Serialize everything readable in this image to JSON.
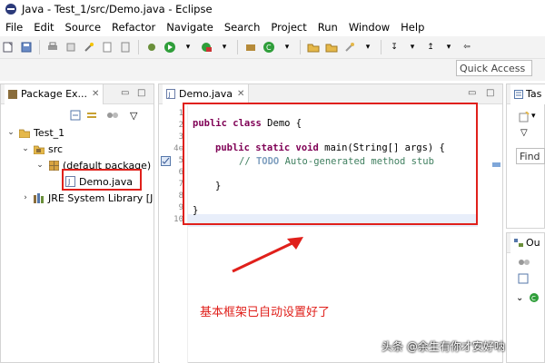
{
  "window": {
    "title": "Java - Test_1/src/Demo.java - Eclipse"
  },
  "menu": [
    "File",
    "Edit",
    "Source",
    "Refactor",
    "Navigate",
    "Search",
    "Project",
    "Run",
    "Window",
    "Help"
  ],
  "toolbar": {
    "quick_access": "Quick Access"
  },
  "package_explorer": {
    "tab_label": "Package Ex...",
    "tree": {
      "project": "Test_1",
      "src": "src",
      "package": "(default package)",
      "file": "Demo.java",
      "library": "JRE System Library [J"
    }
  },
  "editor": {
    "tab_label": "Demo.java",
    "line_numbers": [
      "1",
      "2",
      "3",
      "4⊖",
      "5",
      "6",
      "7",
      "8",
      "9",
      "10"
    ],
    "code": {
      "l2_kw": "public class",
      "l2_rest": " Demo {",
      "l4_kw": "public static void",
      "l4_rest": " main(String[] args) {",
      "l5_prefix": "// ",
      "l5_todo": "TODO",
      "l5_rest": " Auto-generated method stub",
      "l7": "}",
      "l9": "}"
    },
    "annotation": "基本框架已自动设置好了"
  },
  "task_list": {
    "tab_label": "Tas",
    "find_placeholder": "Find"
  },
  "outline": {
    "tab_label": "Ou"
  },
  "watermark": "头条 @余生有你才安好呐",
  "colors": {
    "highlight_red": "#e0201b",
    "keyword": "#7f0055",
    "comment": "#3f7f5f"
  }
}
